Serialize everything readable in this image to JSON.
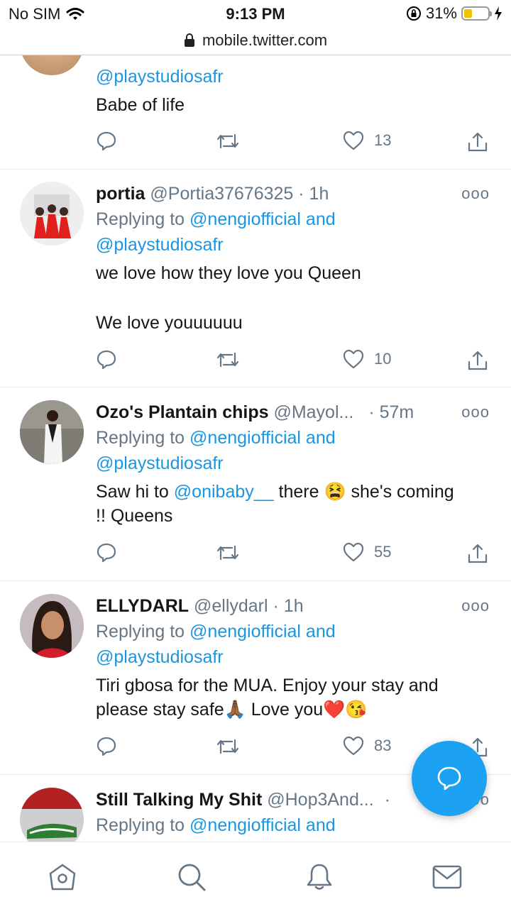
{
  "status": {
    "carrier": "No SIM",
    "time": "9:13 PM",
    "battery_percent": "31%",
    "battery_level": 0.31
  },
  "browser": {
    "url": "mobile.twitter.com"
  },
  "partial_tweet": {
    "mention": "@playstudiosafr",
    "text": "Babe of life",
    "likes": "13"
  },
  "tweets": [
    {
      "name": "portia",
      "handle": "@Portia37676325",
      "time": "· 1h",
      "replying_prefix": "Replying to",
      "replying_to": "@nengiofficial and",
      "replying_to_2": "@playstudiosafr",
      "text_line1": "we love how they love you Queen",
      "text_line2": "We love youuuuuu",
      "likes": "10",
      "more": "ooo"
    },
    {
      "name": "Ozo's Plantain chips",
      "handle": "@Mayol...",
      "time": "· 57m",
      "replying_prefix": "Replying to",
      "replying_to": "@nengiofficial and",
      "replying_to_2": "@playstudiosafr",
      "text_pre": "Saw hi to",
      "text_mention": "@onibaby__",
      "text_post": "there 😫 she's coming",
      "text_line2": "!! Queens",
      "likes": "55",
      "more": "ooo"
    },
    {
      "name": "ELLYDARL",
      "handle": "@ellydarl",
      "time": "· 1h",
      "replying_prefix": "Replying to",
      "replying_to": "@nengiofficial and",
      "replying_to_2": "@playstudiosafr",
      "text_line1": "Tiri gbosa for the MUA. Enjoy your stay and",
      "text_line2": "please stay safe🙏🏾 Love you❤️😘",
      "likes": "83",
      "more": "ooo"
    },
    {
      "name": "Still Talking My Shit",
      "handle": "@Hop3And...",
      "time": "·",
      "replying_prefix": "Replying to",
      "replying_to": "@nengiofficial and",
      "more": "ooo"
    }
  ],
  "colors": {
    "accent": "#1da1f2",
    "link": "#1b95e0",
    "muted": "#657786"
  },
  "icons": [
    "wifi-icon",
    "lock-icon",
    "battery-icon",
    "reply-icon",
    "retweet-icon",
    "like-icon",
    "share-icon",
    "compose-icon",
    "home-icon",
    "search-icon",
    "notifications-icon",
    "messages-icon"
  ]
}
